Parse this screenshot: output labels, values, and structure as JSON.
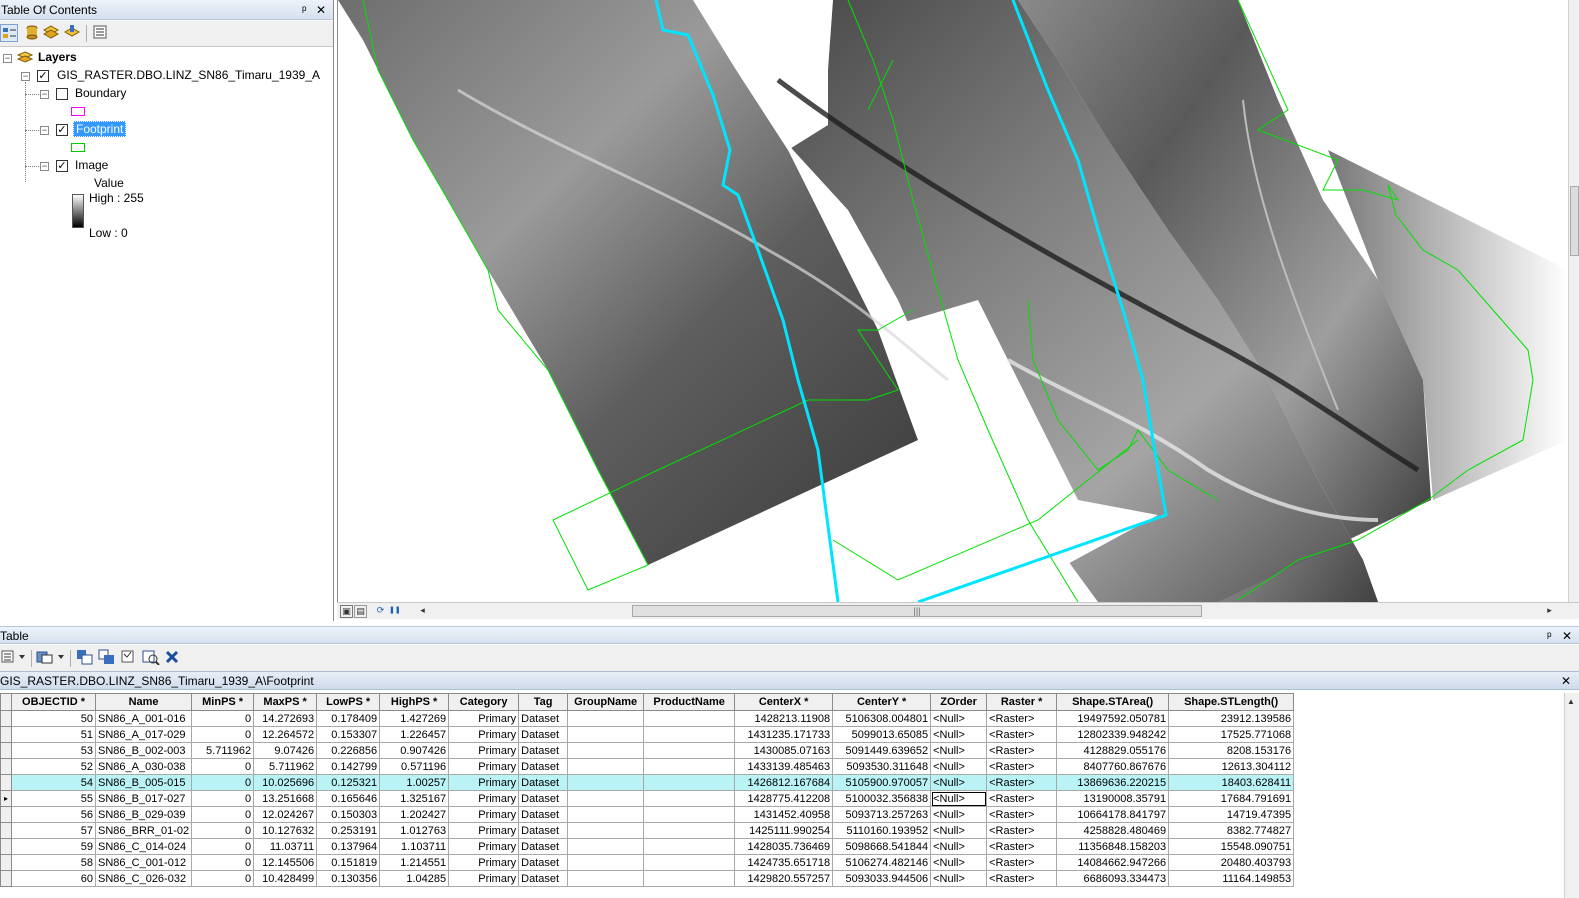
{
  "toc": {
    "title": "Table Of Contents",
    "pin_glyph": "ᵖ",
    "close_glyph": "✕",
    "toolbar_icons": [
      "list-by-drawing-order-icon",
      "list-by-source-icon",
      "list-by-visibility-icon",
      "list-by-selection-icon",
      "options-icon"
    ],
    "tree": {
      "root_label": "Layers",
      "layer_label": "GIS_RASTER.DBO.LINZ_SN86_Timaru_1939_A",
      "sublayers": [
        {
          "label": "Boundary",
          "checked": false,
          "swatch_color": "#ff00ff"
        },
        {
          "label": "Footprint",
          "checked": true,
          "swatch_color": "#00cc00"
        },
        {
          "label": "Image",
          "checked": true
        }
      ],
      "legend_value_label": "Value",
      "legend_high": "High : 255",
      "legend_low": "Low : 0"
    }
  },
  "map": {
    "footprint_color": "#00e000",
    "selected_footprint_color": "#00e5ff",
    "controls": {
      "refresh_icon": "⟳",
      "pause_icon": "❚❚",
      "left_arrow": "◂",
      "right_arrow": "▸",
      "thumb_grip": "|||"
    }
  },
  "table": {
    "title": "Table",
    "tab_label": "GIS_RASTER.DBO.LINZ_SN86_Timaru_1939_A\\Footprint",
    "pin_glyph": "ᵖ",
    "close_glyph": "✕",
    "tab_close_glyph": "✕",
    "columns": [
      "OBJECTID *",
      "Name",
      "MinPS *",
      "MaxPS *",
      "LowPS *",
      "HighPS *",
      "Category",
      "Tag",
      "GroupName",
      "ProductName",
      "CenterX *",
      "CenterY *",
      "ZOrder",
      "Raster *",
      "Shape.STArea()",
      "Shape.STLength()"
    ],
    "rows": [
      {
        "cells": [
          "50",
          "SN86_A_001-016",
          "0",
          "14.272693",
          "0.178409",
          "1.427269",
          "Primary",
          "Dataset",
          "",
          "",
          "1428213.11908",
          "5106308.004801",
          "<Null>",
          "<Raster>",
          "19497592.050781",
          "23912.139586"
        ]
      },
      {
        "cells": [
          "51",
          "SN86_A_017-029",
          "0",
          "12.264572",
          "0.153307",
          "1.226457",
          "Primary",
          "Dataset",
          "",
          "",
          "1431235.171733",
          "5099013.65085",
          "<Null>",
          "<Raster>",
          "12802339.948242",
          "17525.771068"
        ]
      },
      {
        "cells": [
          "53",
          "SN86_B_002-003",
          "5.711962",
          "9.07426",
          "0.226856",
          "0.907426",
          "Primary",
          "Dataset",
          "",
          "",
          "1430085.07163",
          "5091449.639652",
          "<Null>",
          "<Raster>",
          "4128829.055176",
          "8208.153176"
        ]
      },
      {
        "cells": [
          "52",
          "SN86_A_030-038",
          "0",
          "5.711962",
          "0.142799",
          "0.571196",
          "Primary",
          "Dataset",
          "",
          "",
          "1433139.485463",
          "5093530.311648",
          "<Null>",
          "<Raster>",
          "8407760.867676",
          "12613.304112"
        ]
      },
      {
        "cells": [
          "54",
          "SN86_B_005-015",
          "0",
          "10.025696",
          "0.125321",
          "1.00257",
          "Primary",
          "Dataset",
          "",
          "",
          "1426812.167684",
          "5105900.970057",
          "<Null>",
          "<Raster>",
          "13869636.220215",
          "18403.628411"
        ]
      },
      {
        "cells": [
          "55",
          "SN86_B_017-027",
          "0",
          "13.251668",
          "0.165646",
          "1.325167",
          "Primary",
          "Dataset",
          "",
          "",
          "1428775.412208",
          "5100032.356838",
          "<Null>",
          "<Raster>",
          "13190008.35791",
          "17684.791691"
        ]
      },
      {
        "cells": [
          "56",
          "SN86_B_029-039",
          "0",
          "12.024267",
          "0.150303",
          "1.202427",
          "Primary",
          "Dataset",
          "",
          "",
          "1431452.40958",
          "5093713.257263",
          "<Null>",
          "<Raster>",
          "10664178.841797",
          "14719.47395"
        ]
      },
      {
        "cells": [
          "57",
          "SN86_BRR_01-02",
          "0",
          "10.127632",
          "0.253191",
          "1.012763",
          "Primary",
          "Dataset",
          "",
          "",
          "1425111.990254",
          "5110160.193952",
          "<Null>",
          "<Raster>",
          "4258828.480469",
          "8382.774827"
        ]
      },
      {
        "cells": [
          "59",
          "SN86_C_014-024",
          "0",
          "11.03711",
          "0.137964",
          "1.103711",
          "Primary",
          "Dataset",
          "",
          "",
          "1428035.736469",
          "5098668.541844",
          "<Null>",
          "<Raster>",
          "11356848.158203",
          "15548.090751"
        ]
      },
      {
        "cells": [
          "58",
          "SN86_C_001-012",
          "0",
          "12.145506",
          "0.151819",
          "1.214551",
          "Primary",
          "Dataset",
          "",
          "",
          "1424735.651718",
          "5106274.482146",
          "<Null>",
          "<Raster>",
          "14084662.947266",
          "20480.403793"
        ]
      },
      {
        "cells": [
          "60",
          "SN86_C_026-032",
          "0",
          "10.428499",
          "0.130356",
          "1.04285",
          "Primary",
          "Dataset",
          "",
          "",
          "1429820.557257",
          "5093033.944506",
          "<Null>",
          "<Raster>",
          "6686093.334473",
          "11164.149853"
        ]
      }
    ],
    "selected_row_objectid": "54",
    "current_row_objectid": "55",
    "current_row_marker": "▸"
  }
}
